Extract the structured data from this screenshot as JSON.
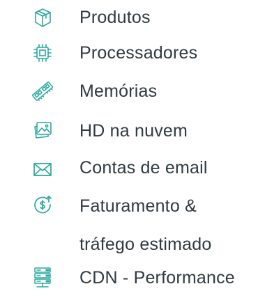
{
  "menu": {
    "items": [
      {
        "label": "Produtos",
        "icon": "box-icon"
      },
      {
        "label": "Processadores",
        "icon": "cpu-chip-icon"
      },
      {
        "label": "Memórias",
        "icon": "memory-ram-icon"
      },
      {
        "label": "HD na nuvem",
        "icon": "cloud-image-icon"
      },
      {
        "label": "Contas de email",
        "icon": "envelope-icon"
      },
      {
        "label": "Faturamento &",
        "label_line2": "tráfego estimado",
        "icon": "dollar-arrow-icon"
      },
      {
        "label": "CDN - Performance",
        "icon": "server-network-icon"
      }
    ]
  },
  "colors": {
    "icon_accent": "#2aa8a0",
    "text": "#2f3a40"
  }
}
